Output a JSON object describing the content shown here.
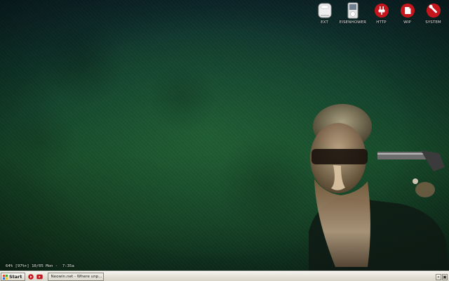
{
  "desktop_icons": [
    {
      "id": "ext",
      "label": "EXT",
      "icon": "drive-icon",
      "color": "#e9e9e9"
    },
    {
      "id": "eisenhower",
      "label": "EISENHOWER",
      "icon": "ipod-icon",
      "color": "#d8d8d8"
    },
    {
      "id": "http",
      "label": "HTTP",
      "icon": "plug-icon",
      "color": "#c4161c"
    },
    {
      "id": "wip",
      "label": "WIP",
      "icon": "document-icon",
      "color": "#c4161c"
    },
    {
      "id": "system",
      "label": "SYSTEM",
      "icon": "wrench-icon",
      "color": "#c4161c"
    }
  ],
  "statusbar": {
    "battery": "64% [97%+]",
    "date": "10/05 Mon",
    "separator": "-",
    "time": "7:35a"
  },
  "taskbar": {
    "start_label": "Start",
    "quick_launch": [
      {
        "icon": "media-player-icon",
        "color": "#c4161c"
      },
      {
        "icon": "youtube-icon",
        "color": "#c4161c"
      }
    ],
    "tasks": [
      {
        "label": "Neowin.net - Where unp...",
        "icon": "firefox-icon"
      }
    ],
    "tray": {
      "collapse_glyph": "«",
      "app_glyph": "▣"
    }
  },
  "colors": {
    "wallpaper_dark": "#0d2a2e",
    "wallpaper_green": "#164a2a",
    "taskbar_bg": "#e3e0d6",
    "accent_red": "#c4161c"
  }
}
